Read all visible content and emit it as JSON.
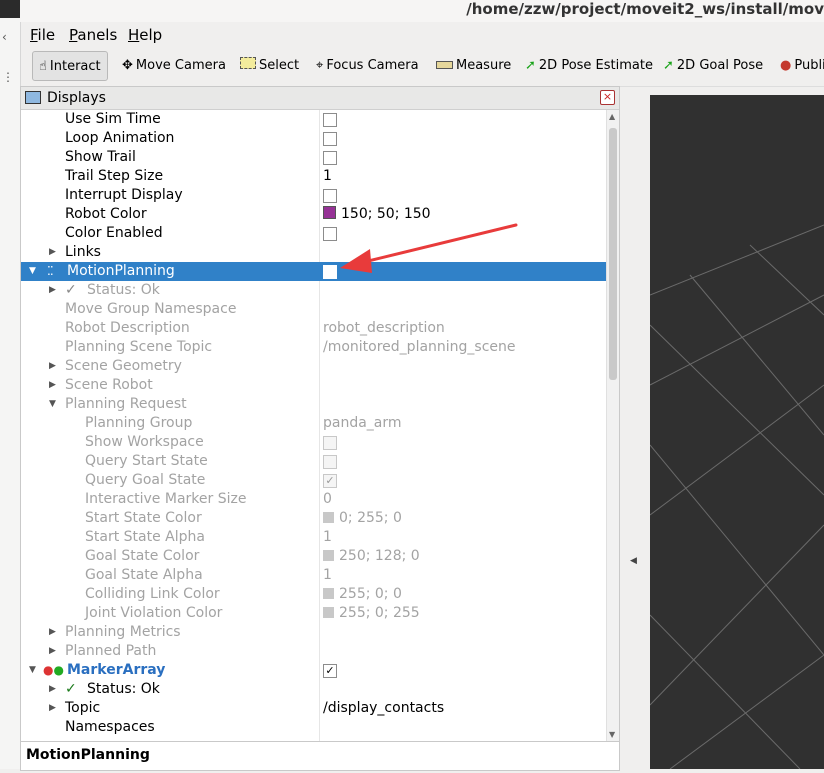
{
  "window": {
    "title": "/home/zzw/project/moveit2_ws/install/mov"
  },
  "menu": [
    {
      "label": "File",
      "u": "F",
      "rest": "ile"
    },
    {
      "label": "Panels",
      "u": "P",
      "rest": "anels"
    },
    {
      "label": "Help",
      "u": "H",
      "rest": "elp"
    }
  ],
  "toolbar": {
    "interact": "Interact",
    "move_camera": "Move Camera",
    "select": "Select",
    "focus_camera": "Focus Camera",
    "measure": "Measure",
    "pose_estimate": "2D Pose Estimate",
    "goal_pose": "2D Goal Pose",
    "publish": "Publi"
  },
  "displays": {
    "title": "Displays",
    "rows": [
      {
        "label": "Use Sim Time",
        "checkbox": "unchecked"
      },
      {
        "label": "Loop Animation",
        "checkbox": "unchecked"
      },
      {
        "label": "Show Trail",
        "checkbox": "unchecked"
      },
      {
        "label": "Trail Step Size",
        "value": "1"
      },
      {
        "label": "Interrupt Display",
        "checkbox": "unchecked"
      },
      {
        "label": "Robot Color",
        "value": "150; 50; 150",
        "swatch": "#963296"
      },
      {
        "label": "Color Enabled",
        "checkbox": "unchecked"
      },
      {
        "label": "Links"
      },
      {
        "label": "MotionPlanning",
        "checkbox": "unchecked"
      },
      {
        "label": "Status: Ok",
        "check_mark": "✓"
      },
      {
        "label": "Move Group Namespace"
      },
      {
        "label": "Robot Description",
        "value": "robot_description"
      },
      {
        "label": "Planning Scene Topic",
        "value": "/monitored_planning_scene"
      },
      {
        "label": "Scene Geometry"
      },
      {
        "label": "Scene Robot"
      },
      {
        "label": "Planning Request"
      },
      {
        "label": "Planning Group",
        "value": "panda_arm"
      },
      {
        "label": "Show Workspace",
        "checkbox": "unchecked"
      },
      {
        "label": "Query Start State",
        "checkbox": "unchecked"
      },
      {
        "label": "Query Goal State",
        "checkbox": "checked"
      },
      {
        "label": "Interactive Marker Size",
        "value": "0"
      },
      {
        "label": "Start State Color",
        "value": "0; 255; 0",
        "swatch": "#c8c8c8"
      },
      {
        "label": "Start State Alpha",
        "value": "1"
      },
      {
        "label": "Goal State Color",
        "value": "250; 128; 0",
        "swatch": "#c8c8c8"
      },
      {
        "label": "Goal State Alpha",
        "value": "1"
      },
      {
        "label": "Colliding Link Color",
        "value": "255; 0; 0",
        "swatch": "#c8c8c8"
      },
      {
        "label": "Joint Violation Color",
        "value": "255; 0; 255",
        "swatch": "#c8c8c8"
      },
      {
        "label": "Planning Metrics"
      },
      {
        "label": "Planned Path"
      },
      {
        "label": "MarkerArray",
        "checkbox": "checked"
      },
      {
        "label": "Status: Ok",
        "check_mark": "✓"
      },
      {
        "label": "Topic",
        "value": "/display_contacts"
      },
      {
        "label": "Namespaces"
      }
    ]
  },
  "bottom_panel": {
    "title": "MotionPlanning"
  },
  "colors": {
    "selection": "#3081c8",
    "marker_label": "#2a6fc0",
    "viewport_bg": "#303030",
    "annotation": "#e83b3b"
  }
}
